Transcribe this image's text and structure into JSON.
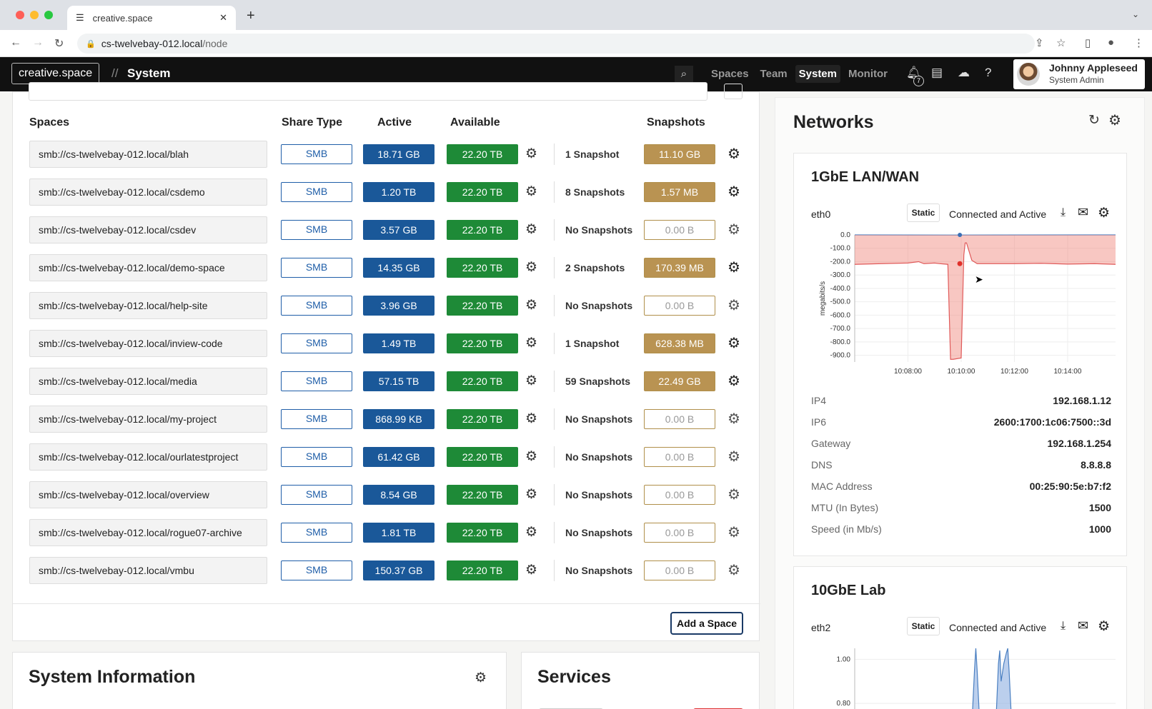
{
  "browser": {
    "tab_title": "creative.space",
    "url_host": "cs-twelvebay-012.local",
    "url_path": "/node"
  },
  "header": {
    "brand": "creative.space",
    "separator": "//",
    "title": "System",
    "nav": [
      "Spaces",
      "Team",
      "System",
      "Monitor"
    ],
    "active_nav": "System",
    "notification_count": "7",
    "user_name": "Johnny Appleseed",
    "user_role": "System Admin"
  },
  "spaces": {
    "headers": {
      "spaces": "Spaces",
      "share_type": "Share Type",
      "active": "Active",
      "available": "Available",
      "snapshots": "Snapshots"
    },
    "rows": [
      {
        "path": "smb://cs-twelvebay-012.local/blah",
        "share": "SMB",
        "active": "18.71 GB",
        "available": "22.20 TB",
        "snapshots": "1 Snapshot",
        "snap_size": "11.10 GB",
        "has_snapshots": true
      },
      {
        "path": "smb://cs-twelvebay-012.local/csdemo",
        "share": "SMB",
        "active": "1.20 TB",
        "available": "22.20 TB",
        "snapshots": "8 Snapshots",
        "snap_size": "1.57 MB",
        "has_snapshots": true
      },
      {
        "path": "smb://cs-twelvebay-012.local/csdev",
        "share": "SMB",
        "active": "3.57 GB",
        "available": "22.20 TB",
        "snapshots": "No Snapshots",
        "snap_size": "0.00 B",
        "has_snapshots": false
      },
      {
        "path": "smb://cs-twelvebay-012.local/demo-space",
        "share": "SMB",
        "active": "14.35 GB",
        "available": "22.20 TB",
        "snapshots": "2 Snapshots",
        "snap_size": "170.39 MB",
        "has_snapshots": true
      },
      {
        "path": "smb://cs-twelvebay-012.local/help-site",
        "share": "SMB",
        "active": "3.96 GB",
        "available": "22.20 TB",
        "snapshots": "No Snapshots",
        "snap_size": "0.00 B",
        "has_snapshots": false
      },
      {
        "path": "smb://cs-twelvebay-012.local/inview-code",
        "share": "SMB",
        "active": "1.49 TB",
        "available": "22.20 TB",
        "snapshots": "1 Snapshot",
        "snap_size": "628.38 MB",
        "has_snapshots": true
      },
      {
        "path": "smb://cs-twelvebay-012.local/media",
        "share": "SMB",
        "active": "57.15 TB",
        "available": "22.20 TB",
        "snapshots": "59 Snapshots",
        "snap_size": "22.49 GB",
        "has_snapshots": true
      },
      {
        "path": "smb://cs-twelvebay-012.local/my-project",
        "share": "SMB",
        "active": "868.99 KB",
        "available": "22.20 TB",
        "snapshots": "No Snapshots",
        "snap_size": "0.00 B",
        "has_snapshots": false
      },
      {
        "path": "smb://cs-twelvebay-012.local/ourlatestproject",
        "share": "SMB",
        "active": "61.42 GB",
        "available": "22.20 TB",
        "snapshots": "No Snapshots",
        "snap_size": "0.00 B",
        "has_snapshots": false
      },
      {
        "path": "smb://cs-twelvebay-012.local/overview",
        "share": "SMB",
        "active": "8.54 GB",
        "available": "22.20 TB",
        "snapshots": "No Snapshots",
        "snap_size": "0.00 B",
        "has_snapshots": false
      },
      {
        "path": "smb://cs-twelvebay-012.local/rogue07-archive",
        "share": "SMB",
        "active": "1.81 TB",
        "available": "22.20 TB",
        "snapshots": "No Snapshots",
        "snap_size": "0.00 B",
        "has_snapshots": false
      },
      {
        "path": "smb://cs-twelvebay-012.local/vmbu",
        "share": "SMB",
        "active": "150.37 GB",
        "available": "22.20 TB",
        "snapshots": "No Snapshots",
        "snap_size": "0.00 B",
        "has_snapshots": false
      }
    ],
    "add_button": "Add a Space"
  },
  "system_info": {
    "title": "System Information"
  },
  "services": {
    "title": "Services"
  },
  "networks": {
    "title": "Networks",
    "interfaces": [
      {
        "name": "1GbE LAN/WAN",
        "device": "eth0",
        "mode": "Static",
        "status": "Connected and Active",
        "details": [
          {
            "label": "IP4",
            "value": "192.168.1.12"
          },
          {
            "label": "IP6",
            "value": "2600:1700:1c06:7500::3d"
          },
          {
            "label": "Gateway",
            "value": "192.168.1.254"
          },
          {
            "label": "DNS",
            "value": "8.8.8.8"
          },
          {
            "label": "MAC Address",
            "value": "00:25:90:5e:b7:f2"
          },
          {
            "label": "MTU (In Bytes)",
            "value": "1500"
          },
          {
            "label": "Speed (in Mb/s)",
            "value": "1000"
          }
        ]
      },
      {
        "name": "10GbE Lab",
        "device": "eth2",
        "mode": "Static",
        "status": "Connected and Active"
      }
    ]
  },
  "chart_data": [
    {
      "type": "area",
      "ylabel": "megabits/s",
      "yticks": [
        "0.0",
        "-100.0",
        "-200.0",
        "-300.0",
        "-400.0",
        "-500.0",
        "-600.0",
        "-700.0",
        "-800.0",
        "-900.0"
      ],
      "xticks": [
        "10:08:00",
        "10:10:00",
        "10:12:00",
        "10:14:00"
      ],
      "ylim": [
        -950,
        0
      ],
      "xlim_minutes": [
        6.0,
        15.8
      ],
      "series": [
        {
          "color": "#4a7fc1",
          "x": [
            6.0,
            9.55,
            9.62,
            15.8
          ],
          "y": [
            0,
            -1,
            -1,
            0
          ]
        },
        {
          "color": "#e05a5a",
          "x": [
            6.0,
            7.0,
            8.0,
            8.4,
            8.6,
            9.0,
            9.2,
            9.5,
            9.6,
            9.7,
            10.0,
            10.1,
            10.15,
            10.2,
            10.4,
            10.6,
            11.0,
            12.0,
            13.0,
            14.0,
            15.0,
            15.8
          ],
          "y": [
            -220,
            -215,
            -210,
            -200,
            -215,
            -210,
            -215,
            -220,
            -930,
            -930,
            -920,
            -150,
            -60,
            -60,
            -190,
            -215,
            -215,
            -215,
            -212,
            -218,
            -215,
            -220
          ]
        }
      ]
    },
    {
      "type": "area",
      "yticks": [
        "1.00",
        "0.80"
      ],
      "ylim": [
        0.7,
        1.05
      ],
      "xlim_minutes": [
        6.0,
        15.8
      ],
      "series": [
        {
          "color": "#4a7fc1",
          "x": [
            10.4,
            10.5,
            10.55,
            10.6,
            10.7,
            11.3,
            11.4,
            11.45,
            11.5,
            11.6,
            11.7,
            11.75,
            11.8,
            11.9
          ],
          "y": [
            0.7,
            0.95,
            1.05,
            0.95,
            0.7,
            0.7,
            0.98,
            1.04,
            0.9,
            0.98,
            1.03,
            1.05,
            0.95,
            0.7
          ]
        }
      ]
    }
  ]
}
